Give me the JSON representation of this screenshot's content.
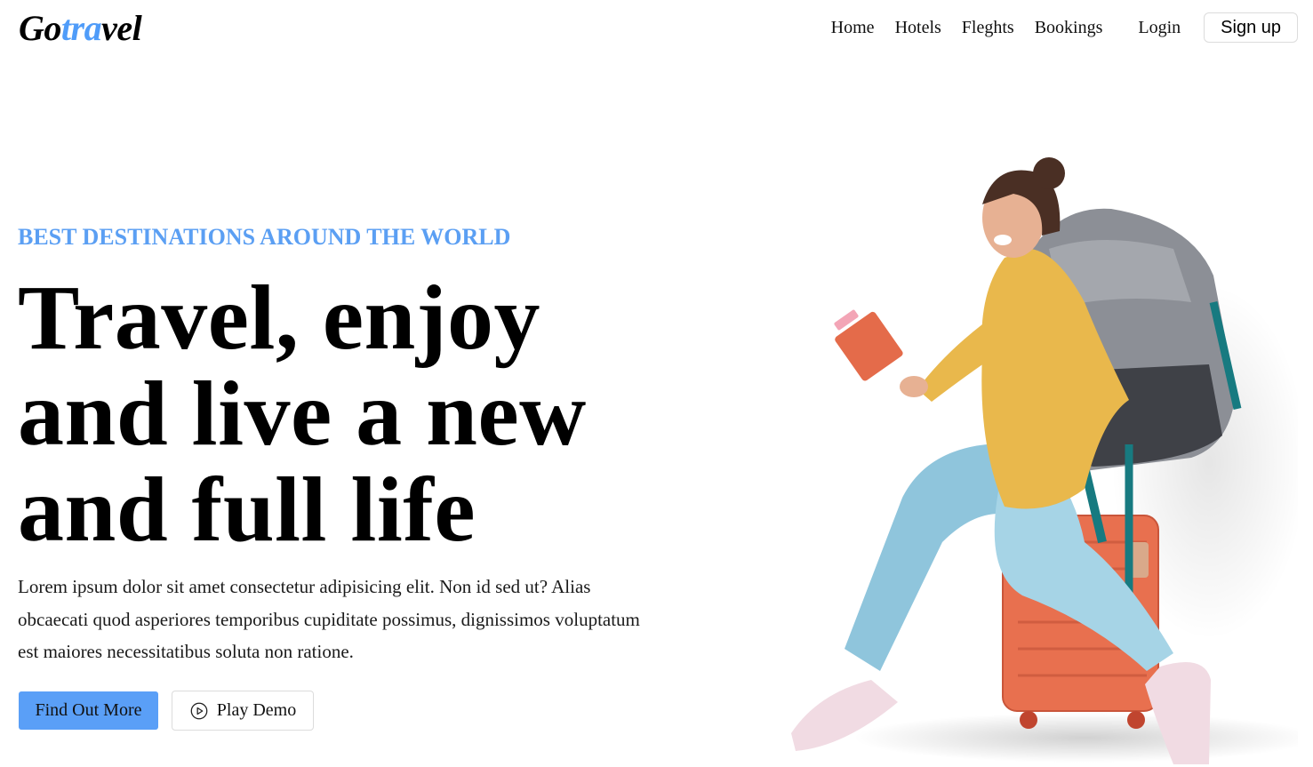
{
  "brand": {
    "logo_part1": "Go",
    "logo_accent": "tra",
    "logo_part2": "vel",
    "accent_color": "#4f9cf9"
  },
  "nav": {
    "links": [
      "Home",
      "Hotels",
      "Fleghts",
      "Bookings"
    ],
    "login": "Login",
    "signup": "Sign up"
  },
  "hero": {
    "eyebrow": "BEST DESTINATIONS AROUND THE WORLD",
    "headline_line1": "Travel, enjoy",
    "headline_line2": "and live a new",
    "headline_line3": "and full life",
    "description": "Lorem ipsum dolor sit amet consectetur adipisicing elit. Non id sed ut? Alias obcaecati quod asperiores temporibus cupiditate possimus, dignissimos voluptatum est maiores necessitatibus soluta non ratione.",
    "primary_button": "Find Out More",
    "secondary_button": "Play Demo",
    "secondary_icon": "play-circle-icon",
    "image_subject": "traveler-with-backpack-on-suitcase"
  },
  "colors": {
    "primary_button": "#5a9ff7",
    "eyebrow": "#5b9ff3",
    "suitcase": "#e8704f",
    "hoodie": "#e9b84c",
    "jeans": "#8fc5dc",
    "backpack": "#8c8f96"
  }
}
